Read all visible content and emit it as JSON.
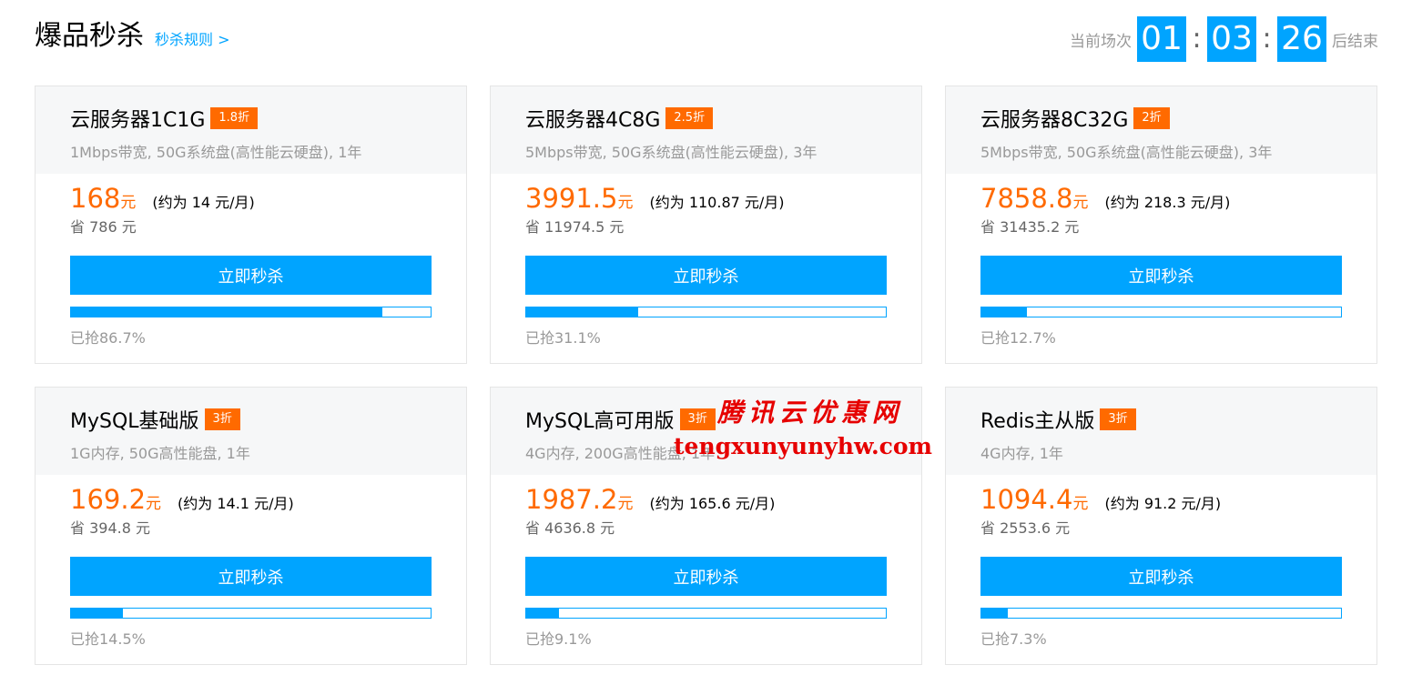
{
  "header": {
    "title": "爆品秒杀",
    "rules_link": "秒杀规则 >",
    "countdown": {
      "prefix": "当前场次",
      "hours": "01",
      "minutes": "03",
      "seconds": "26",
      "separator": ":",
      "suffix": "后结束"
    }
  },
  "products": [
    {
      "name": "云服务器1C1G",
      "discount": "1.8折",
      "spec": "1Mbps带宽, 50G系统盘(高性能云硬盘), 1年",
      "price": "168",
      "unit": "元",
      "monthly": "(约为 14 元/月)",
      "save": "省 786 元",
      "button": "立即秒杀",
      "sold_label": "已抢86.7%",
      "sold_fraction": 0.867
    },
    {
      "name": "云服务器4C8G",
      "discount": "2.5折",
      "spec": "5Mbps带宽, 50G系统盘(高性能云硬盘), 3年",
      "price": "3991.5",
      "unit": "元",
      "monthly": "(约为 110.87 元/月)",
      "save": "省 11974.5 元",
      "button": "立即秒杀",
      "sold_label": "已抢31.1%",
      "sold_fraction": 0.311
    },
    {
      "name": "云服务器8C32G",
      "discount": "2折",
      "spec": "5Mbps带宽, 50G系统盘(高性能云硬盘), 3年",
      "price": "7858.8",
      "unit": "元",
      "monthly": "(约为 218.3 元/月)",
      "save": "省 31435.2 元",
      "button": "立即秒杀",
      "sold_label": "已抢12.7%",
      "sold_fraction": 0.127
    },
    {
      "name": "MySQL基础版",
      "discount": "3折",
      "spec": "1G内存, 50G高性能盘, 1年",
      "price": "169.2",
      "unit": "元",
      "monthly": "(约为 14.1 元/月)",
      "save": "省 394.8 元",
      "button": "立即秒杀",
      "sold_label": "已抢14.5%",
      "sold_fraction": 0.145
    },
    {
      "name": "MySQL高可用版",
      "discount": "3折",
      "spec": "4G内存, 200G高性能盘, 1年",
      "price": "1987.2",
      "unit": "元",
      "monthly": "(约为 165.6 元/月)",
      "save": "省 4636.8 元",
      "button": "立即秒杀",
      "sold_label": "已抢9.1%",
      "sold_fraction": 0.091
    },
    {
      "name": "Redis主从版",
      "discount": "3折",
      "spec": "4G内存, 1年",
      "price": "1094.4",
      "unit": "元",
      "monthly": "(约为 91.2 元/月)",
      "save": "省 2553.6 元",
      "button": "立即秒杀",
      "sold_label": "已抢7.3%",
      "sold_fraction": 0.073
    }
  ],
  "watermark": {
    "cn": "腾讯云优惠网",
    "en": "tengxunyunyhw.com"
  },
  "colors": {
    "accent": "#00a4ff",
    "price": "#ff6a00",
    "discount_badge": "#ff6a00",
    "watermark": "#e60000"
  }
}
